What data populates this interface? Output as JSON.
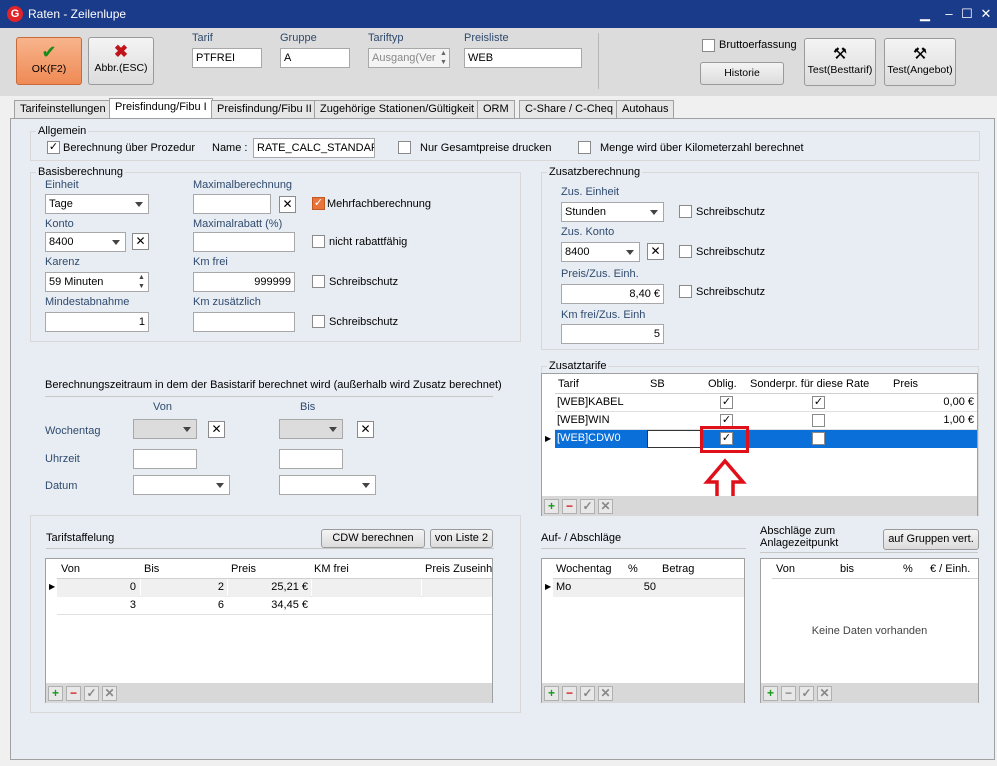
{
  "window": {
    "title": "Raten - Zeilenlupe",
    "logo": "G"
  },
  "toolbar": {
    "ok_label": "OK(F2)",
    "cancel_label": "Abbr.(ESC)",
    "tarif_label": "Tarif",
    "tarif_value": "PTFREI",
    "gruppe_label": "Gruppe",
    "gruppe_value": "A",
    "tariftyp_label": "Tariftyp",
    "tariftyp_value": "Ausgang(Ver",
    "preisliste_label": "Preisliste",
    "preisliste_value": "WEB",
    "brutto_label": "Bruttoerfassung",
    "historie_label": "Historie",
    "test_best_label": "Test(Besttarif)",
    "test_ang_label": "Test(Angebot)"
  },
  "tabs": [
    "Tarifeinstellungen",
    "Preisfindung/Fibu I",
    "Preisfindung/Fibu II",
    "Zugehörige Stationen/Gültigkeit",
    "ORM",
    "C-Share / C-Cheq",
    "Autohaus"
  ],
  "allgemein": {
    "title": "Allgemein",
    "prozedur_label": "Berechnung über Prozedur",
    "name_label": "Name :",
    "name_value": "RATE_CALC_STANDAR",
    "gesamtpreise_label": "Nur Gesamtpreise drucken",
    "menge_label": "Menge wird über Kilometerzahl berechnet"
  },
  "basis": {
    "title": "Basisberechnung",
    "einheit_label": "Einheit",
    "einheit_value": "Tage",
    "maxber_label": "Maximalberechnung",
    "maxber_value": "",
    "mehrfach_label": "Mehrfachberechnung",
    "konto_label": "Konto",
    "konto_value": "8400",
    "maxrabatt_label": "Maximalrabatt (%)",
    "maxrabatt_value": "",
    "nichtrabatt_label": "nicht rabattfähig",
    "karenz_label": "Karenz",
    "karenz_value": "59 Minuten",
    "kmfrei_label": "Km frei",
    "kmfrei_value": "999999",
    "schreibschutz_label": "Schreibschutz",
    "mindest_label": "Mindestabnahme",
    "mindest_value": "1",
    "kmzus_label": "Km zusätzlich",
    "kmzus_value": "",
    "schreibschutz2_label": "Schreibschutz"
  },
  "zeitraum": {
    "title": "Berechnungszeitraum in dem der Basistarif berechnet wird (außerhalb wird Zusatz berechnet)",
    "von_label": "Von",
    "bis_label": "Bis",
    "wochentag_label": "Wochentag",
    "uhrzeit_label": "Uhrzeit",
    "datum_label": "Datum"
  },
  "zusatz": {
    "title": "Zusatzberechnung",
    "einheit_label": "Zus. Einheit",
    "einheit_value": "Stunden",
    "konto_label": "Zus. Konto",
    "konto_value": "8400",
    "preis_label": "Preis/Zus. Einh.",
    "preis_value": "8,40 €",
    "kmfrei_label": "Km frei/Zus. Einh",
    "kmfrei_value": "5",
    "schreibschutz_label": "Schreibschutz"
  },
  "zusatztarife": {
    "title": "Zusatztarife",
    "columns": [
      "Tarif",
      "SB",
      "Oblig.",
      "Sonderpr. für diese Rate",
      "Preis"
    ],
    "rows": [
      {
        "tarif": "[WEB]KABEL",
        "sb": "",
        "oblig": true,
        "sonder": true,
        "preis": "0,00 €"
      },
      {
        "tarif": "[WEB]WIN",
        "sb": "",
        "oblig": true,
        "sonder": false,
        "preis": "1,00 €"
      },
      {
        "tarif": "[WEB]CDW0",
        "sb": "",
        "oblig": true,
        "sonder": false,
        "preis": ""
      }
    ]
  },
  "staffel": {
    "title": "Tarifstaffelung",
    "cdw_label": "CDW berechnen",
    "liste_label": "von Liste 2",
    "columns": [
      "Von",
      "Bis",
      "Preis",
      "KM frei",
      "Preis Zuseinh"
    ],
    "rows": [
      {
        "von": "0",
        "bis": "2",
        "preis": "25,21 €",
        "km": "",
        "pz": ""
      },
      {
        "von": "3",
        "bis": "6",
        "preis": "34,45 €",
        "km": "",
        "pz": ""
      }
    ]
  },
  "aufab": {
    "title": "Auf- / Abschläge",
    "columns": [
      "Wochentag",
      "%",
      "Betrag"
    ],
    "rows": [
      {
        "tag": "Mo",
        "pct": "50",
        "betrag": ""
      }
    ]
  },
  "anlage": {
    "title_line1": "Abschläge zum",
    "title_line2": "Anlagezeitpunkt",
    "gruppen_label": "auf Gruppen vert.",
    "columns": [
      "Von",
      "bis",
      "%",
      "€ / Einh."
    ],
    "empty": "Keine Daten vorhanden"
  },
  "colors": {
    "titlebar": "#1a3a8a",
    "ok": "#f39a6b",
    "selection": "#0a6fd8",
    "highlight": "#e0101a"
  }
}
